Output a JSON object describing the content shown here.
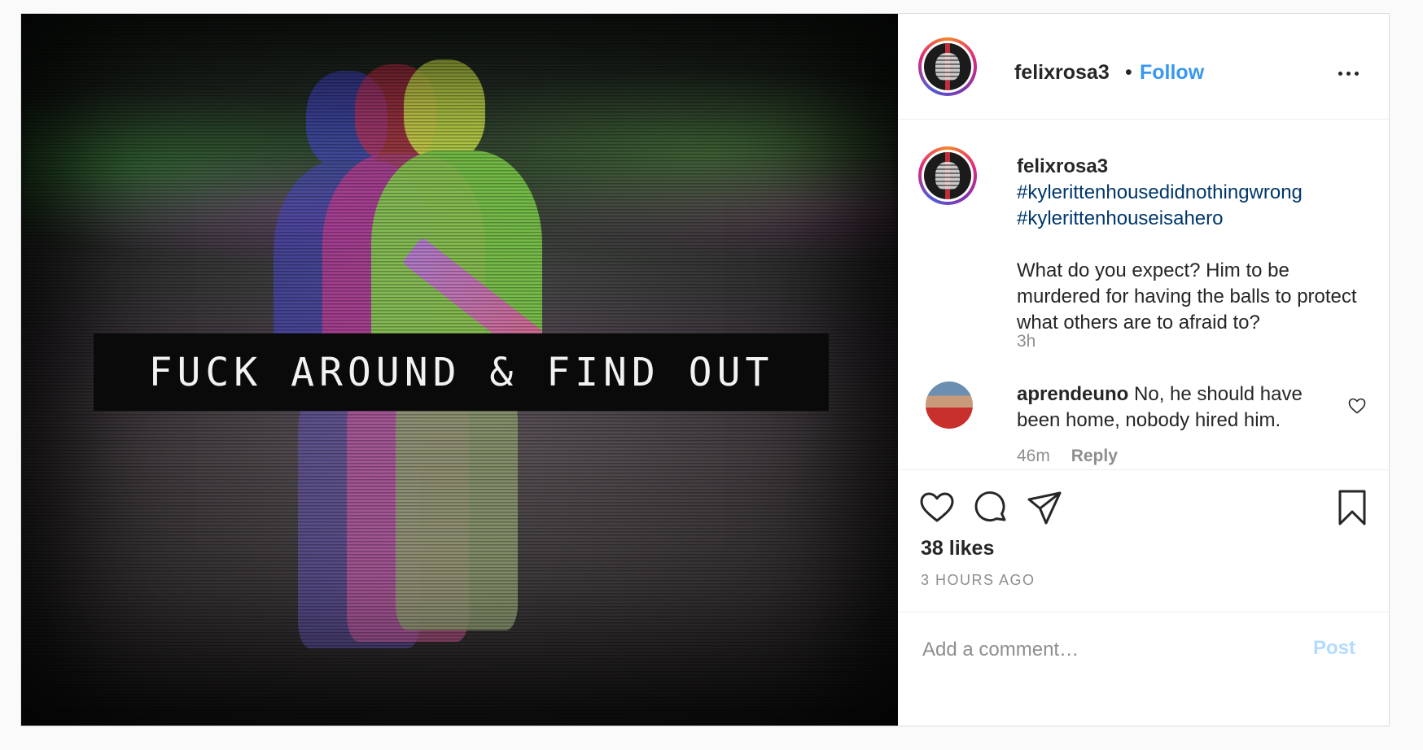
{
  "post": {
    "image": {
      "overlay_text": "FUCK AROUND & FIND OUT"
    },
    "header": {
      "username": "felixrosa3",
      "separator": "•",
      "follow_label": "Follow"
    },
    "caption": {
      "username": "felixrosa3",
      "hashtags": [
        "#kylerittenhousedidnothingwrong",
        "#kylerittenhouseisahero"
      ],
      "text": "What do you expect? Him to be murdered for having the balls to protect what others are to afraid to?",
      "time": "3h"
    },
    "comments": [
      {
        "username": "aprendeuno",
        "text": "No, he should have been home, nobody hired him.",
        "time": "46m",
        "reply_label": "Reply"
      }
    ],
    "likes": "38 likes",
    "timestamp": "3 HOURS AGO",
    "add_comment": {
      "placeholder": "Add a comment…",
      "post_label": "Post"
    }
  },
  "icons": {
    "like": "heart-icon",
    "comment": "comment-icon",
    "share": "paper-plane-icon",
    "save": "bookmark-icon",
    "more": "more-options-icon"
  },
  "colors": {
    "link_blue": "#3897f0",
    "hashtag": "#00376b",
    "post_disabled": "#b3dbff",
    "muted_text": "#8e8e8e"
  }
}
